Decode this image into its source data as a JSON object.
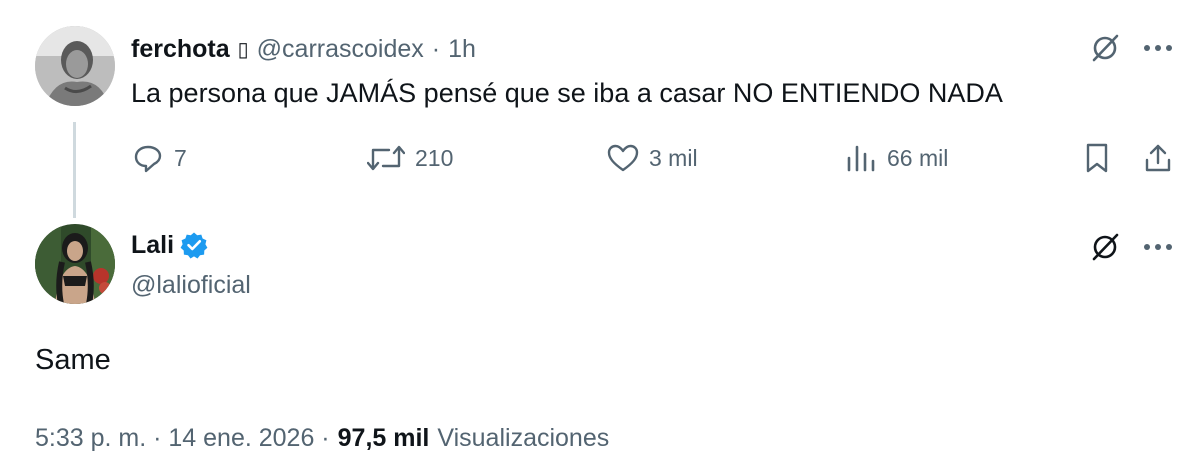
{
  "parent_tweet": {
    "author_name": "ferchota",
    "name_glyph": "▯",
    "handle": "@carrascoidex",
    "separator": "·",
    "time": "1h",
    "text": "La persona que JAMÁS pensé que se iba a casar NO ENTIENDO NADA",
    "replies": "7",
    "retweets": "210",
    "likes": "3 mil",
    "views": "66 mil"
  },
  "reply_tweet": {
    "author_name": "Lali",
    "handle": "@lalioficial",
    "text": "Same",
    "timestamp": "5:33 p. m. · 14 ene. 2026 ·",
    "views_count": "97,5 mil",
    "views_label": "Visualizaciones"
  },
  "colors": {
    "text": "#0f1419",
    "muted": "#536471",
    "verified": "#1d9bf0",
    "thread_line": "#cfd9de"
  },
  "icons": [
    "grok-icon",
    "more-icon",
    "reply-icon",
    "retweet-icon",
    "like-icon",
    "views-icon",
    "bookmark-icon",
    "share-icon",
    "verified-badge-icon"
  ]
}
